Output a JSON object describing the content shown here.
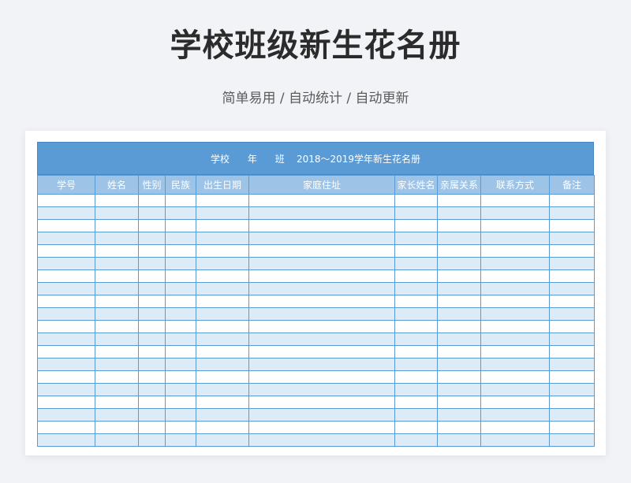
{
  "header": {
    "title": "学校班级新生花名册",
    "subtitle": "简单易用 / 自动统计 / 自动更新"
  },
  "sheet": {
    "banner": "学校      年      班    2018～2019学年新生花名册",
    "columns": [
      "学号",
      "姓名",
      "性别",
      "民族",
      "出生日期",
      "家庭住址",
      "家长姓名",
      "亲属关系",
      "联系方式",
      "备注"
    ],
    "row_count": 20,
    "colors": {
      "banner_bg": "#5b9bd5",
      "header_bg": "#9dc3e6",
      "stripe_bg": "#ddebf7",
      "grid_line": "#5b9bd5"
    }
  }
}
